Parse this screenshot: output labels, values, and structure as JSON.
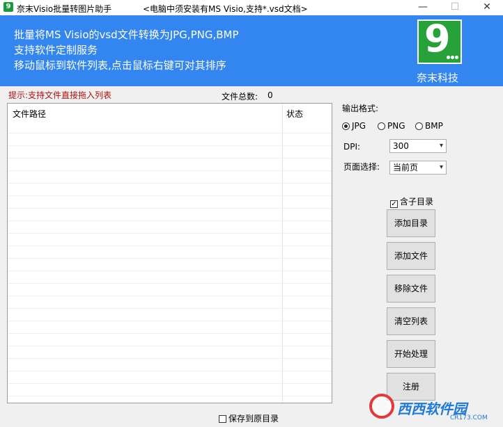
{
  "window": {
    "app_icon_glyph": "9",
    "title": "奈末Visio批量转图片助手",
    "subtitle": "<电脑中须安装有MS Visio,支持*.vsd文档>",
    "minimize_glyph": "—",
    "maximize_glyph": "☐",
    "close_glyph": "✕"
  },
  "banner": {
    "line1": "批量将MS Visio的vsd文件转换为JPG,PNG,BMP",
    "line2": "支持软件定制服务",
    "line3": "移动鼠标到软件列表,点击鼠标右键可对其排序",
    "logo_glyph": "9",
    "logo_caption": "奈末科技",
    "brand_color": "#27a23a",
    "banner_color": "#3385f0"
  },
  "list_area": {
    "hint": "提示:支持文件直接拖入列表",
    "count_label": "文件总数:",
    "count_value": "0",
    "columns": [
      "文件路径",
      "状态"
    ]
  },
  "options": {
    "format_label": "输出格式:",
    "formats": [
      {
        "label": "JPG",
        "selected": true
      },
      {
        "label": "PNG",
        "selected": false
      },
      {
        "label": "BMP",
        "selected": false
      }
    ],
    "dpi_label": "DPI:",
    "dpi_value": "300",
    "page_label": "页面选择:",
    "page_value": "当前页",
    "include_subdir_label": "含子目录",
    "include_subdir_checked": true,
    "check_glyph": "✓",
    "dropdown_glyph": "▾"
  },
  "buttons": {
    "add_dir": "添加目录",
    "add_file": "添加文件",
    "remove_file": "移除文件",
    "clear_list": "清空列表",
    "start": "开始处理",
    "register": "注册"
  },
  "bottom": {
    "save_original_label": "保存到原目录",
    "save_original_checked": false
  },
  "watermark": {
    "text": "西西软件园",
    "url": "CR173.COM"
  }
}
